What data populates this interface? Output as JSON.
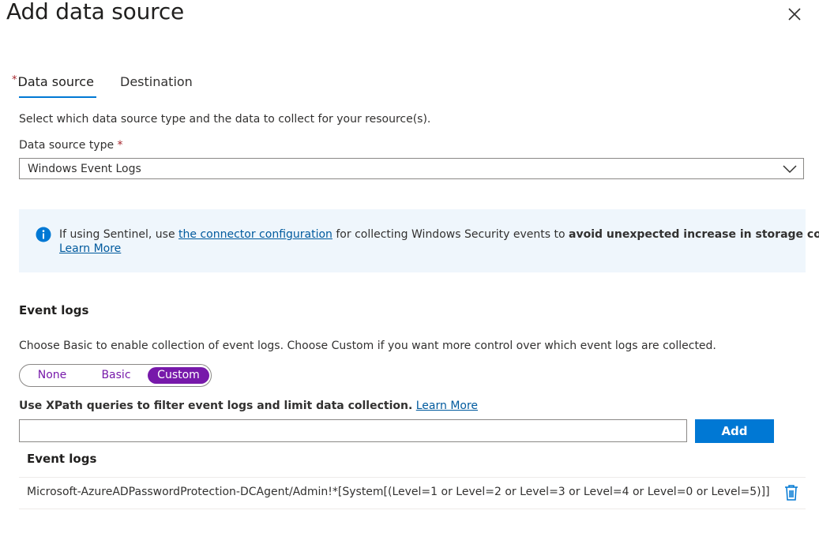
{
  "panel": {
    "title": "Add data source"
  },
  "tabs": [
    {
      "label": "Data source",
      "required_mark": "*",
      "active": true
    },
    {
      "label": "Destination",
      "active": false
    }
  ],
  "data_source": {
    "intro": "Select which data source type and the data to collect for your resource(s).",
    "type_label": "Data source type",
    "required_mark": "*",
    "type_value": "Windows Event Logs"
  },
  "info": {
    "text_before_link": "If using Sentinel, use ",
    "link_text": "the connector configuration",
    "text_after_link": " for collecting Windows Security events to ",
    "bold_text": "avoid unexpected increase in storage cost.",
    "learn_more": "Learn More"
  },
  "event_logs": {
    "heading": "Event logs",
    "description": "Choose Basic to enable collection of event logs. Choose Custom if you want more control over which event logs are collected.",
    "options": [
      "None",
      "Basic",
      "Custom"
    ],
    "selected": "Custom",
    "xpath_label": "Use XPath queries to filter event logs and limit data collection.",
    "xpath_learn_more": "Learn More",
    "xpath_value": "",
    "add_button": "Add",
    "table_header": "Event logs",
    "rows": [
      "Microsoft-AzureADPasswordProtection-DCAgent/Admin!*[System[(Level=1 or Level=2 or Level=3 or Level=4 or Level=0 or Level=5)]]"
    ]
  },
  "colors": {
    "accent": "#0078d4",
    "toggle": "#7719aa",
    "info_bg": "#eff6fc",
    "required": "#a4262c"
  },
  "icons": {
    "close": "close-icon",
    "chevron": "chevron-down-icon",
    "info": "info-icon",
    "delete": "trash-icon"
  }
}
